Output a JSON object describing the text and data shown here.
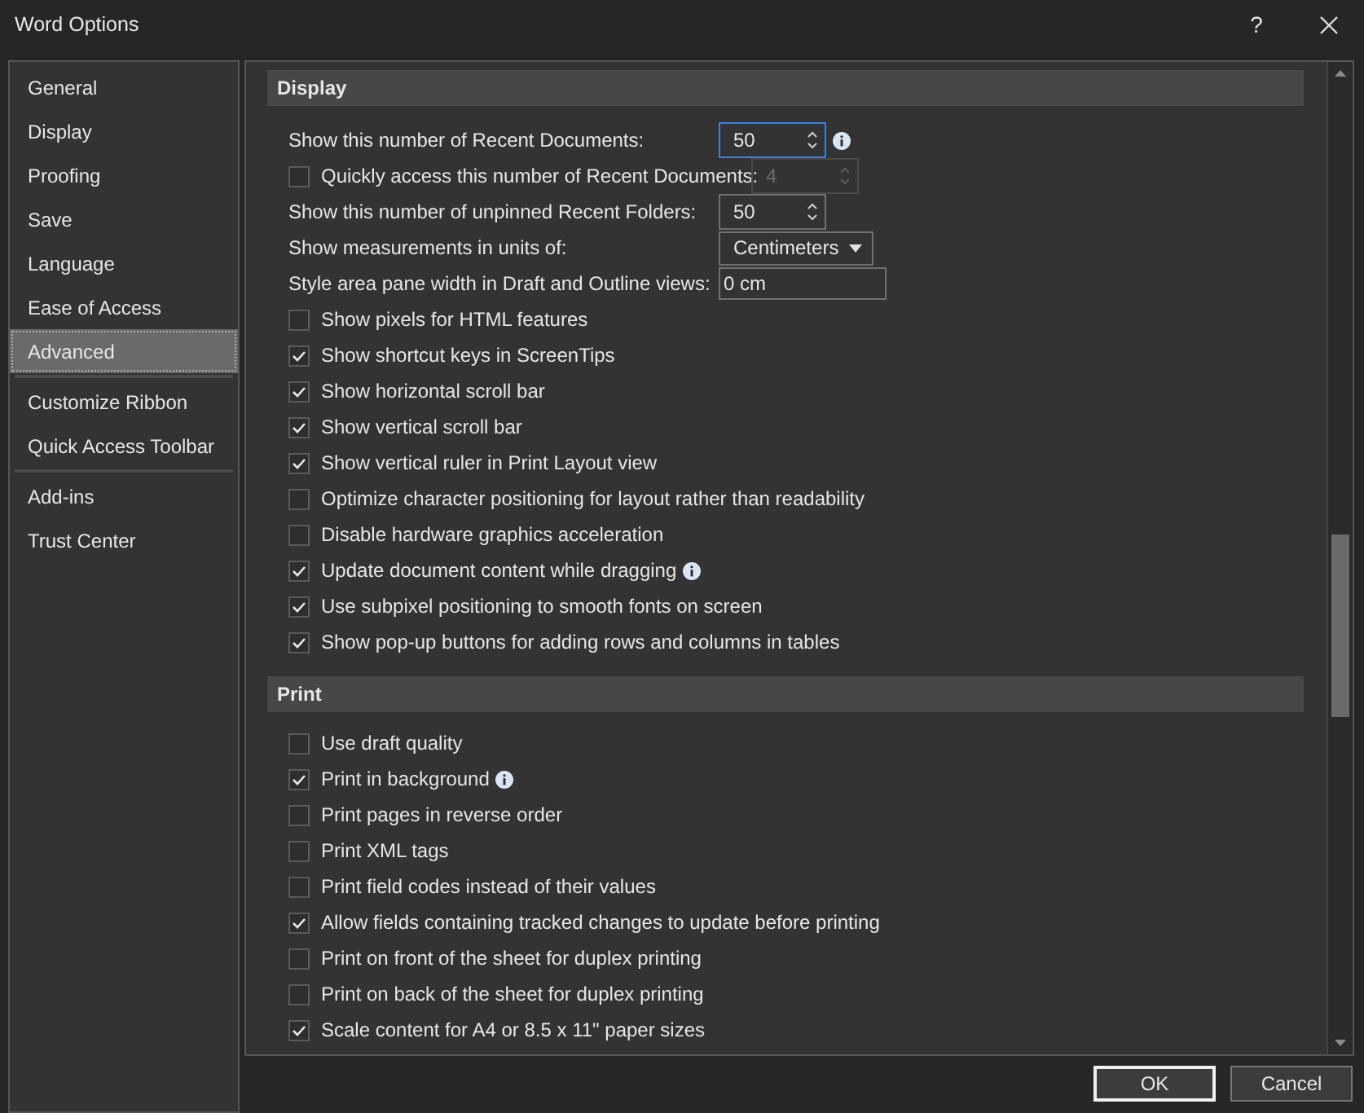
{
  "window": {
    "title": "Word Options",
    "help": "?"
  },
  "sidebar": {
    "items": [
      {
        "label": "General",
        "selected": false,
        "divider_after": false
      },
      {
        "label": "Display",
        "selected": false,
        "divider_after": false
      },
      {
        "label": "Proofing",
        "selected": false,
        "divider_after": false
      },
      {
        "label": "Save",
        "selected": false,
        "divider_after": false
      },
      {
        "label": "Language",
        "selected": false,
        "divider_after": false
      },
      {
        "label": "Ease of Access",
        "selected": false,
        "divider_after": false
      },
      {
        "label": "Advanced",
        "selected": true,
        "divider_after": true
      },
      {
        "label": "Customize Ribbon",
        "selected": false,
        "divider_after": false
      },
      {
        "label": "Quick Access Toolbar",
        "selected": false,
        "divider_after": true
      },
      {
        "label": "Add-ins",
        "selected": false,
        "divider_after": false
      },
      {
        "label": "Trust Center",
        "selected": false,
        "divider_after": false
      }
    ]
  },
  "sections": [
    {
      "title": "Display",
      "items": [
        {
          "kind": "spinner",
          "label": "Show this number of Recent Documents:",
          "value": "50",
          "focused": true,
          "info": true
        },
        {
          "kind": "checkspinner",
          "label": "Quickly access this number of Recent Documents:",
          "checked": false,
          "value": "4",
          "disabled": true
        },
        {
          "kind": "spinner",
          "label": "Show this number of unpinned Recent Folders:",
          "value": "50",
          "focused": false,
          "info": false
        },
        {
          "kind": "dropdown",
          "label": "Show measurements in units of:",
          "value": "Centimeters"
        },
        {
          "kind": "text",
          "label": "Style area pane width in Draft and Outline views:",
          "value": "0 cm"
        },
        {
          "kind": "checkbox",
          "label": "Show pixels for HTML features",
          "checked": false,
          "info": false
        },
        {
          "kind": "checkbox",
          "label": "Show shortcut keys in ScreenTips",
          "checked": true,
          "info": false
        },
        {
          "kind": "checkbox",
          "label": "Show horizontal scroll bar",
          "checked": true,
          "info": false
        },
        {
          "kind": "checkbox",
          "label": "Show vertical scroll bar",
          "checked": true,
          "info": false
        },
        {
          "kind": "checkbox",
          "label": "Show vertical ruler in Print Layout view",
          "checked": true,
          "info": false
        },
        {
          "kind": "checkbox",
          "label": "Optimize character positioning for layout rather than readability",
          "checked": false,
          "info": false
        },
        {
          "kind": "checkbox",
          "label": "Disable hardware graphics acceleration",
          "checked": false,
          "info": false
        },
        {
          "kind": "checkbox",
          "label": "Update document content while dragging",
          "checked": true,
          "info": true
        },
        {
          "kind": "checkbox",
          "label": "Use subpixel positioning to smooth fonts on screen",
          "checked": true,
          "info": false
        },
        {
          "kind": "checkbox",
          "label": "Show pop-up buttons for adding rows and columns in tables",
          "checked": true,
          "info": false
        }
      ]
    },
    {
      "title": "Print",
      "items": [
        {
          "kind": "checkbox",
          "label": "Use draft quality",
          "checked": false,
          "info": false
        },
        {
          "kind": "checkbox",
          "label": "Print in background",
          "checked": true,
          "info": true
        },
        {
          "kind": "checkbox",
          "label": "Print pages in reverse order",
          "checked": false,
          "info": false
        },
        {
          "kind": "checkbox",
          "label": "Print XML tags",
          "checked": false,
          "info": false
        },
        {
          "kind": "checkbox",
          "label": "Print field codes instead of their values",
          "checked": false,
          "info": false
        },
        {
          "kind": "checkbox",
          "label": "Allow fields containing tracked changes to update before printing",
          "checked": true,
          "info": false
        },
        {
          "kind": "checkbox",
          "label": "Print on front of the sheet for duplex printing",
          "checked": false,
          "info": false
        },
        {
          "kind": "checkbox",
          "label": "Print on back of the sheet for duplex printing",
          "checked": false,
          "info": false
        },
        {
          "kind": "checkbox",
          "label": "Scale content for A4 or 8.5 x 11\" paper sizes",
          "checked": true,
          "info": false
        }
      ]
    }
  ],
  "buttons": [
    {
      "label": "OK",
      "default": true
    },
    {
      "label": "Cancel",
      "default": false
    }
  ]
}
